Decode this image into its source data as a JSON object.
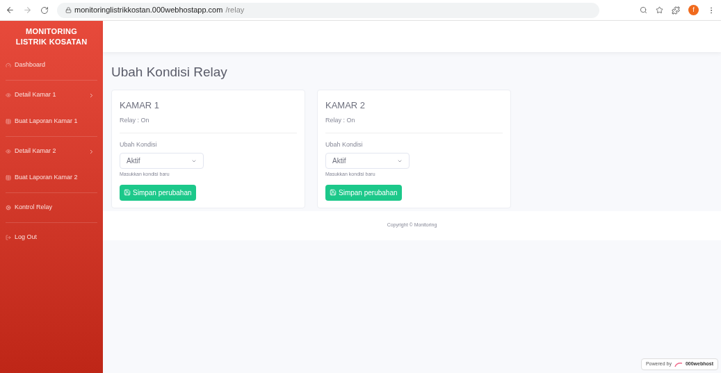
{
  "browser": {
    "url_host": "monitoringlistrikkostan.000webhostapp.com",
    "url_path": "/relay",
    "profile_initial": "f"
  },
  "sidebar": {
    "brand": [
      "MONITORING",
      "LISTRIK KOSATAN"
    ],
    "items": [
      {
        "kind": "link",
        "label": "Dashboard"
      },
      {
        "kind": "divider"
      },
      {
        "kind": "dropdown",
        "label": "Detail Kamar 1"
      },
      {
        "kind": "link",
        "label": "Buat Laporan Kamar 1"
      },
      {
        "kind": "divider"
      },
      {
        "kind": "dropdown",
        "label": "Detail Kamar 2"
      },
      {
        "kind": "link",
        "label": "Buat Laporan Kamar 2"
      },
      {
        "kind": "divider"
      },
      {
        "kind": "link",
        "label": "Kontrol Relay"
      },
      {
        "kind": "divider"
      },
      {
        "kind": "link",
        "label": "Log Out"
      }
    ]
  },
  "page_title": "Ubah Kondisi Relay",
  "cards": [
    {
      "title": "KAMAR 1",
      "status": "Relay : On",
      "field_label": "Ubah Kondisi",
      "select_value": "Aktif",
      "help": "Masukkan kondisi baru",
      "button": "Simpan perubahan"
    },
    {
      "title": "KAMAR 2",
      "status": "Relay : On",
      "field_label": "Ubah Kondisi",
      "select_value": "Aktif",
      "help": "Masukkan kondisi baru",
      "button": "Simpan perubahan"
    }
  ],
  "footer": "Copyright © Monitoring",
  "badge": {
    "prefix": "Powered by",
    "brand": "000webhost"
  }
}
